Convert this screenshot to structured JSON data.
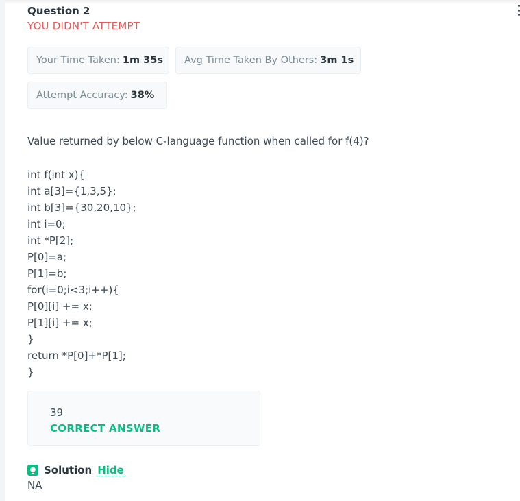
{
  "question": {
    "title": "Question 2",
    "status": "YOU DIDN'T ATTEMPT",
    "text": "Value returned by below C-language function when called for f(4)?",
    "code_lines": [
      "int f(int x){",
      "int a[3]={1,3,5};",
      "int b[3]={30,20,10};",
      "int i=0;",
      "int *P[2];",
      "P[0]=a;",
      "P[1]=b;",
      "for(i=0;i<3;i++){",
      "P[0][i] += x;",
      "P[1][i] += x;",
      "}",
      "return *P[0]+*P[1];",
      "}"
    ]
  },
  "stats": {
    "time_label": "Your Time Taken:",
    "time_value": "1m 35s",
    "avg_label": "Avg Time Taken By Others:",
    "avg_value": "3m 1s",
    "accuracy_label": "Attempt Accuracy:",
    "accuracy_value": "38%"
  },
  "answer": {
    "value": "39",
    "label": "CORRECT ANSWER"
  },
  "solution": {
    "label": "Solution",
    "toggle": "Hide",
    "text": "NA"
  },
  "menu_icon": "more-vertical-icon",
  "colors": {
    "status_red": "#eb5757",
    "accent_green": "#08bd80"
  }
}
